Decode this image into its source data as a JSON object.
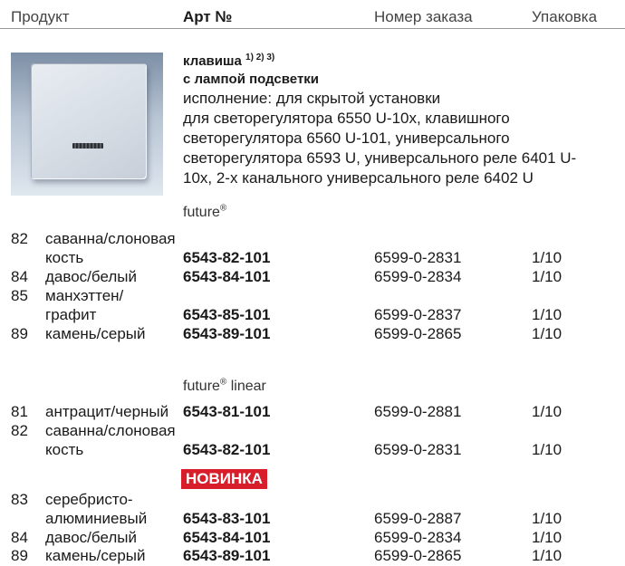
{
  "header": {
    "col_product": "Продукт",
    "col_art": "Арт №",
    "col_order": "Номер заказа",
    "col_pack": "Упаковка"
  },
  "product": {
    "title_line1": "клавиша",
    "title_sup": "1) 2) 3)",
    "title_line2": "с лампой подсветки",
    "description": [
      "исполнение: для скрытой установки",
      "для светорегулятора 6550 U-10x, клавишного",
      "светорегулятора 6560 U-101, универсального",
      "светорегулятора 6593 U, универсального реле 6401 U-",
      "10x, 2-х канального универсального реле 6402 U"
    ]
  },
  "series": [
    {
      "name": "future",
      "reg": "®",
      "suffix": "",
      "rows": [
        {
          "code": "82",
          "name": "саванна/слоновая",
          "art": "",
          "order": "",
          "pack": ""
        },
        {
          "code": "",
          "name": "кость",
          "art": "6543-82-101",
          "order": "6599-0-2831",
          "pack": "1/10"
        },
        {
          "code": "84",
          "name": "давос/белый",
          "art": "6543-84-101",
          "order": "6599-0-2834",
          "pack": "1/10"
        },
        {
          "code": "85",
          "name": "манхэттен/",
          "art": "",
          "order": "",
          "pack": ""
        },
        {
          "code": "",
          "name": "графит",
          "art": "6543-85-101",
          "order": "6599-0-2837",
          "pack": "1/10"
        },
        {
          "code": "89",
          "name": "камень/серый",
          "art": "6543-89-101",
          "order": "6599-0-2865",
          "pack": "1/10"
        }
      ]
    },
    {
      "name": "future",
      "reg": "®",
      "suffix": " linear",
      "rows": [
        {
          "code": "81",
          "name": "антрацит/черный",
          "art": "6543-81-101",
          "order": "6599-0-2881",
          "pack": "1/10"
        },
        {
          "code": "82",
          "name": "саванна/слоновая",
          "art": "",
          "order": "",
          "pack": ""
        },
        {
          "code": "",
          "name": "кость",
          "art": "6543-82-101",
          "order": "6599-0-2831",
          "pack": "1/10"
        },
        {
          "code": "83",
          "name": "серебристо-",
          "art": "",
          "order": "",
          "pack": ""
        },
        {
          "code": "",
          "name": "алюминиевый",
          "art": "6543-83-101",
          "order": "6599-0-2887",
          "pack": "1/10"
        },
        {
          "code": "84",
          "name": "давос/белый",
          "art": "6543-84-101",
          "order": "6599-0-2834",
          "pack": "1/10"
        },
        {
          "code": "89",
          "name": "камень/серый",
          "art": "6543-89-101",
          "order": "6599-0-2865",
          "pack": "1/10"
        }
      ]
    }
  ],
  "badge": {
    "label": "НОВИНКА",
    "color": "#d81e2a"
  }
}
